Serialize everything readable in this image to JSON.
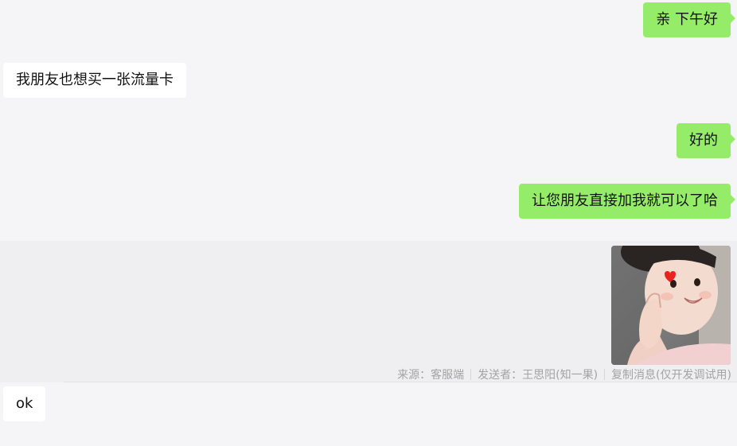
{
  "messages": [
    {
      "text": "亲 下午好"
    },
    {
      "text": "我朋友也想买一张流量卡"
    },
    {
      "text": "好的"
    },
    {
      "text": "让您朋友直接加我就可以了哈"
    },
    {
      "text": "ok"
    }
  ],
  "image_message": {
    "meta": {
      "source": "来源：客服端",
      "sender": "发送者：王思阳(知一果)",
      "copy_action": "复制消息(仅开发调试用)"
    }
  },
  "colors": {
    "outgoing_bubble": "#95ec69",
    "incoming_bubble": "#ffffff",
    "background": "#f5f5f7",
    "meta_text": "#a3a3a3"
  }
}
